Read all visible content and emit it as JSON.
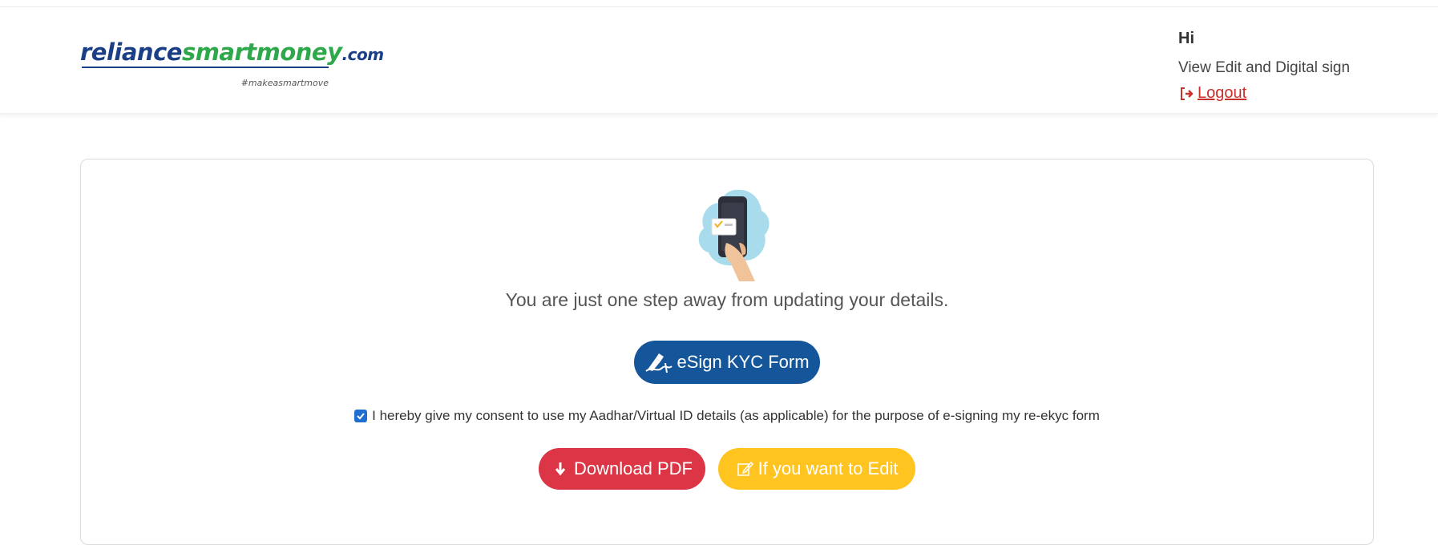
{
  "header": {
    "logo": {
      "part1": "reliance",
      "part2": "smartmoney",
      "part3": ".com",
      "tagline": "#makeasmartmove"
    },
    "user": {
      "greeting": "Hi",
      "subtitle": "View Edit and Digital sign",
      "logout_label": "Logout",
      "logout_icon": "sign-out-icon"
    }
  },
  "main": {
    "illustration": "phone-in-hand-illustration",
    "message": "You are just one step away from updating your details.",
    "esign_button": {
      "label": "eSign KYC Form",
      "icon": "signature-pen-icon"
    },
    "consent": {
      "checked": true,
      "text": "I hereby give my consent to use my Aadhar/Virtual ID details (as applicable) for the purpose of e-signing my re-ekyc form"
    },
    "download_button": {
      "label": "Download PDF",
      "icon": "download-arrow-icon"
    },
    "edit_button": {
      "label": "If you want to Edit",
      "icon": "edit-icon"
    }
  },
  "colors": {
    "brand_blue": "#1b3f86",
    "brand_green": "#2ea84a",
    "esign_button": "#15569a",
    "download_button": "#dc3545",
    "edit_button": "#ffc41f",
    "logout": "#c9302c"
  }
}
